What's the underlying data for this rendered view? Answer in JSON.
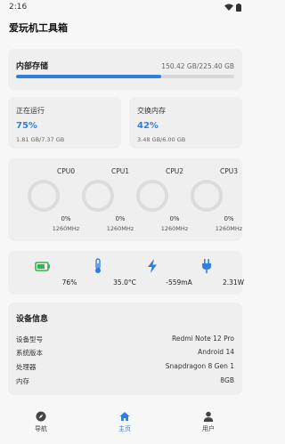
{
  "status_bar": {
    "time": "2:16"
  },
  "app": {
    "title": "爱玩机工具箱"
  },
  "storage": {
    "title": "内部存储",
    "value": "150.42 GB/225.40 GB",
    "used_fraction": 0.667
  },
  "memory": {
    "ram": {
      "label": "正在运行",
      "percent": "75%",
      "detail": "1.81 GB/7.37 GB"
    },
    "swap": {
      "label": "交换内存",
      "percent": "42%",
      "detail": "3.48 GB/6.00 GB"
    }
  },
  "cpu": {
    "cores": [
      {
        "name": "CPU0",
        "usage": "0%",
        "freq": "1260MHz"
      },
      {
        "name": "CPU1",
        "usage": "0%",
        "freq": "1260MHz"
      },
      {
        "name": "CPU2",
        "usage": "0%",
        "freq": "1260MHz"
      },
      {
        "name": "CPU3",
        "usage": "0%",
        "freq": "1260MHz"
      }
    ]
  },
  "sensors": {
    "battery": {
      "icon": "battery-icon",
      "value": "76%",
      "color": "#2fb84a"
    },
    "temperature": {
      "icon": "thermometer-icon",
      "value": "35.0°C",
      "color": "#2f7ee0"
    },
    "current": {
      "icon": "bolt-icon",
      "value": "-559mA",
      "color": "#2f7ee0"
    },
    "power": {
      "icon": "plug-icon",
      "value": "2.31W",
      "color": "#2f7ee0"
    }
  },
  "device": {
    "title": "设备信息",
    "rows": [
      {
        "key": "设备型号",
        "value": "Redmi Note 12 Pro"
      },
      {
        "key": "系统版本",
        "value": "Android 14"
      },
      {
        "key": "处理器",
        "value": "Snapdragon 8 Gen 1"
      },
      {
        "key": "内存",
        "value": "8GB"
      }
    ]
  },
  "nav": {
    "items": [
      {
        "label": "导航",
        "icon": "compass-icon"
      },
      {
        "label": "主页",
        "icon": "home-icon",
        "active": true
      },
      {
        "label": "用户",
        "icon": "user-icon"
      }
    ]
  },
  "colors": {
    "accent": "#2f7ee0",
    "battery": "#2fb84a",
    "card": "#efefef"
  }
}
